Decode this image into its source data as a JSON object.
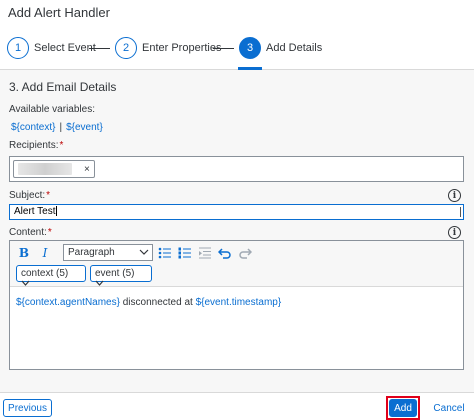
{
  "dialog": {
    "title": "Add Alert Handler"
  },
  "wizard": {
    "steps": [
      {
        "number": "1",
        "label": "Select Event"
      },
      {
        "number": "2",
        "label": "Enter Properties"
      },
      {
        "number": "3",
        "label": "Add Details"
      }
    ],
    "active_step": 3
  },
  "section": {
    "title": "3. Add Email Details",
    "available_variables_label": "Available variables:",
    "variables": [
      "${context}",
      "${event}"
    ],
    "variables_separator": "|"
  },
  "recipients": {
    "label": "Recipients:",
    "required_mark": "*",
    "token_remove": "×"
  },
  "subject": {
    "label": "Subject:",
    "required_mark": "*",
    "value": "Alert Test"
  },
  "content": {
    "label": "Content:",
    "required_mark": "*",
    "toolbar": {
      "bold": "B",
      "italic": "I",
      "paragraph_select": "Paragraph",
      "variable_selects": [
        "context (5)",
        "event (5)"
      ]
    },
    "body": {
      "token1": "${context.agentNames}",
      "text": " disconnected at ",
      "token2": "${event.timestamp}"
    }
  },
  "info_icon_glyph": "i",
  "footer": {
    "previous": "Previous",
    "add": "Add",
    "cancel": "Cancel"
  },
  "colors": {
    "accent": "#0a6ed1",
    "required": "#bb0000",
    "highlight": "#e0001a"
  }
}
